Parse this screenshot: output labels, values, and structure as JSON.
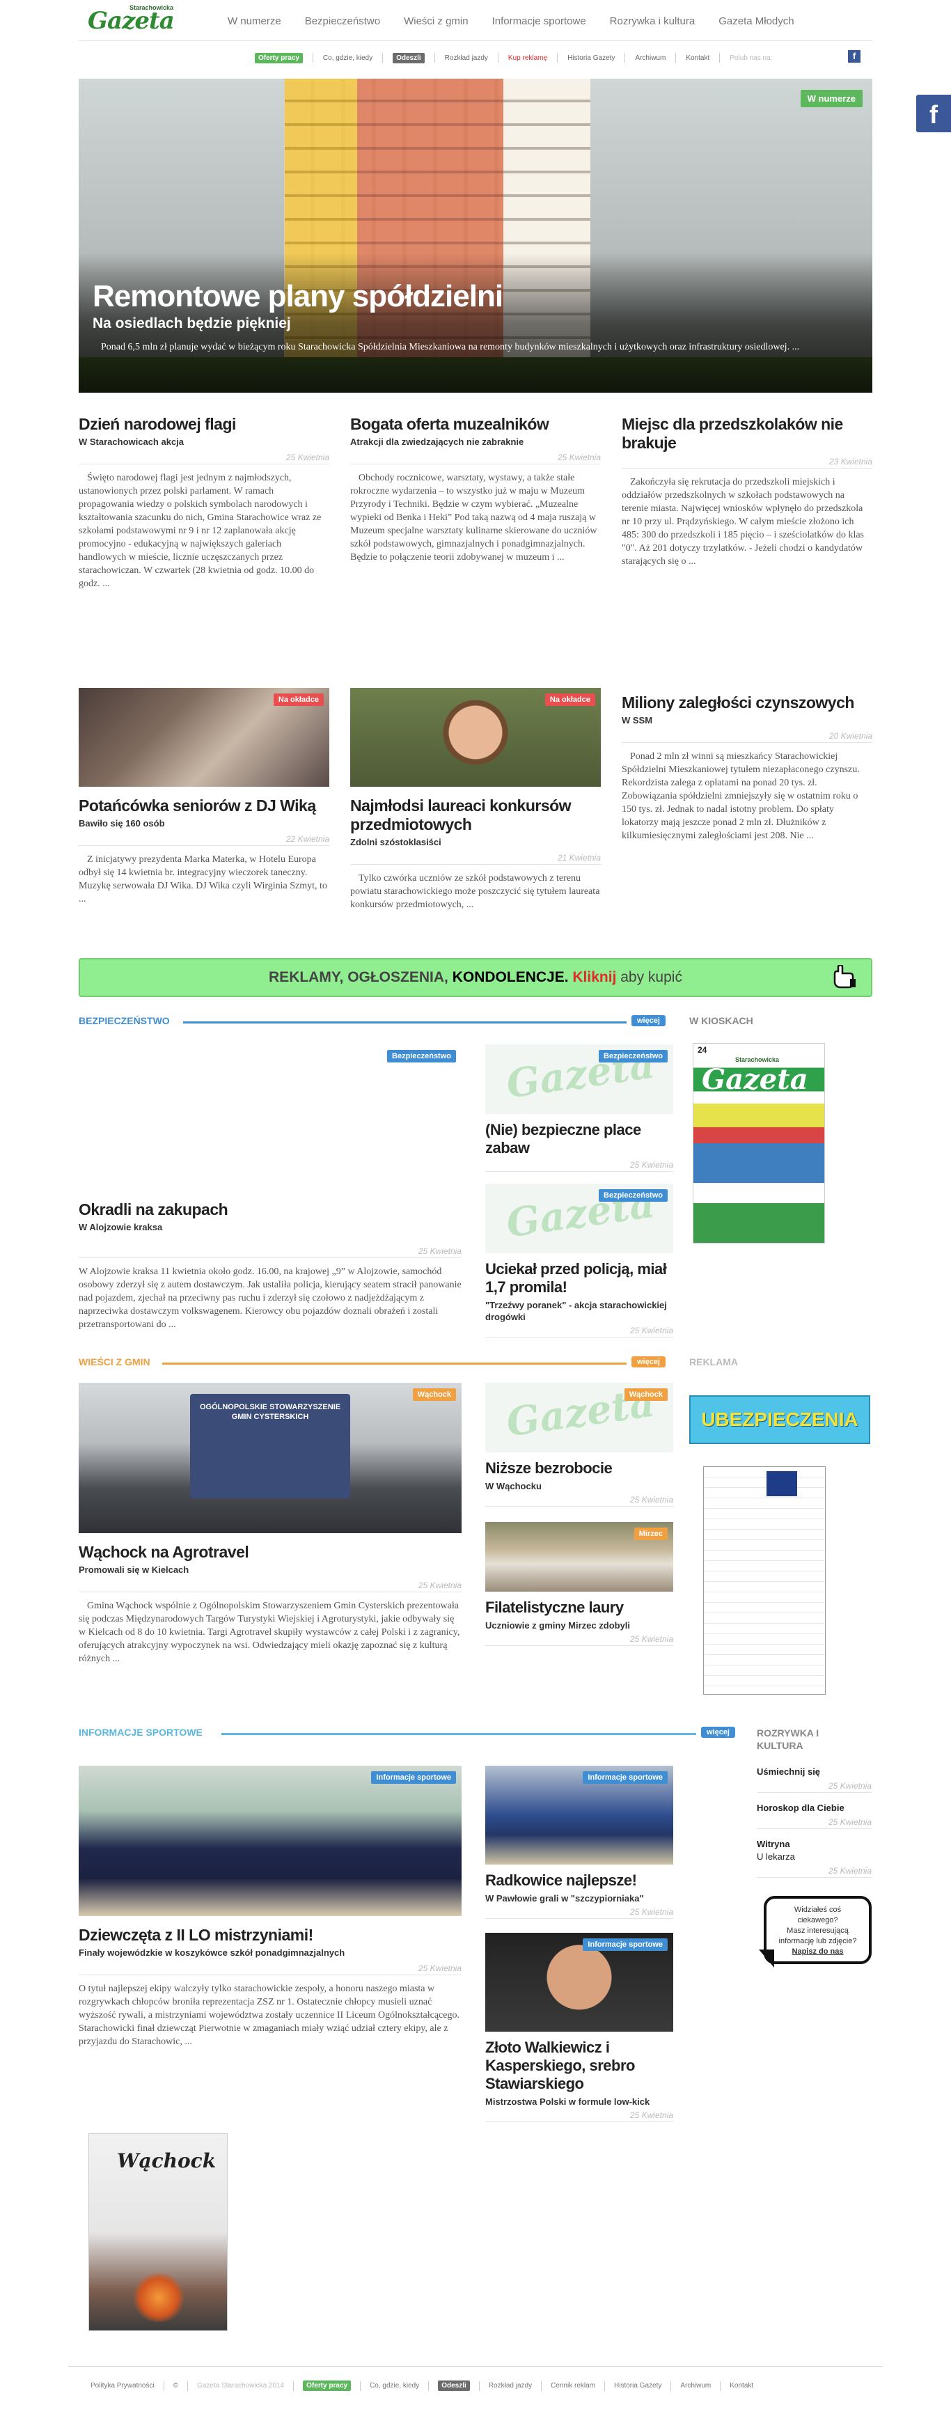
{
  "header": {
    "logo_small": "Starachowicka",
    "logo_big": "Gazeta",
    "nav": [
      "W numerze",
      "Bezpieczeństwo",
      "Wieści z gmin",
      "Informacje sportowe",
      "Rozrywka i kultura",
      "Gazeta Młodych"
    ],
    "subnav": {
      "oferty": "Oferty pracy",
      "co_gdzie": "Co, gdzie, kiedy",
      "odeszli": "Odeszli",
      "rozklad": "Rozkład jazdy",
      "kup": "Kup reklamę",
      "historia": "Historia Gazety",
      "archiwum": "Archiwum",
      "kontakt": "Kontakt",
      "polub": "Polub nas na:"
    },
    "fb_letter": "f"
  },
  "hero": {
    "badge": "W numerze",
    "title": "Remontowe plany spółdzielni",
    "subtitle": "Na osiedlach będzie piękniej",
    "text": "Ponad 6,5 mln zł planuje wydać w bieżącym roku Starachowicka Spółdzielnia Mieszkaniowa na remonty budynków mieszkalnych i użytkowych oraz infrastruktury osiedlowej. ..."
  },
  "row1": [
    {
      "title": "Dzień narodowej flagi",
      "lead": "W Starachowicach akcja",
      "date": "25 Kwietnia",
      "body": "Święto narodowej flagi jest jednym z najmłodszych, ustanowionych przez polski parlament. W ramach propagowania wiedzy o polskich symbolach narodowych i kształtowania szacunku do nich, Gmina Starachowice wraz ze szkołami podstawowymi nr 9 i nr 12 zaplanowała akcję promocyjno - edukacyjną w największych galeriach handlowych w mieście, licznie uczęszczanych przez starachowiczan. W czwartek (28 kwietnia od godz. 10.00 do godz. ..."
    },
    {
      "title": "Bogata oferta muzealników",
      "lead": "Atrakcji dla zwiedzających nie zabraknie",
      "date": "25 Kwietnia",
      "body": "Obchody rocznicowe, warsztaty, wystawy, a także stałe rokroczne wydarzenia – to wszystko już w maju w Muzeum Przyrody i Techniki. Będzie w czym wybierać. „Muzealne wypieki od Benka i Heki” Pod taką nazwą od 4 maja ruszają w Muzeum specjalne warsztaty kulinarne skierowane do uczniów szkół podstawowych, gimnazjalnych i ponadgimnazjalnych. Będzie to połączenie teorii zdobywanej w muzeum i ..."
    },
    {
      "title": "Miejsc dla przedszkolaków nie brakuje",
      "lead": "",
      "date": "23 Kwietnia",
      "body": "Zakończyła się rekrutacja do przedszkoli miejskich i oddziałów przedszkolnych w szkołach podstawowych na terenie miasta. Najwięcej wniosków wpłynęło do przedszkola nr 10 przy ul. Prądzyńskiego. W całym mieście złożono ich 485: 300 do przedszkoli i 185 pięcio – i sześciolatków do klas \"0\". Aż 201 dotyczy trzylatków. - Jeżeli chodzi o kandydatów starających się o ..."
    }
  ],
  "row2": [
    {
      "badge": "Na okładce",
      "title": "Potańcówka seniorów z DJ Wiką",
      "lead": "Bawiło się 160 osób",
      "date": "22 Kwietnia",
      "body": "Z inicjatywy prezydenta Marka Materka, w Hotelu Europa odbył się 14 kwietnia br. integracyjny wieczorek taneczny. Muzykę serwowała DJ Wika. DJ Wika czyli Wirginia Szmyt, to ..."
    },
    {
      "badge": "Na okładce",
      "title": "Najmłodsi laureaci konkursów przedmiotowych",
      "lead": "Zdolni szóstoklasiści",
      "date": "21 Kwietnia",
      "body": "Tylko czwórka uczniów ze szkół podstawowych z terenu powiatu starachowickiego może poszczycić się tytułem laureata konkursów przedmiotowych, ..."
    },
    {
      "title": "Miliony zaległości czynszowych",
      "lead": "W SSM",
      "date": "20 Kwietnia",
      "body": "Ponad 2 mln zł winni są mieszkańcy Starachowickiej Spółdzielni Mieszkaniowej tytułem niezapłaconego czynszu. Rekordzista zalega z opłatami na ponad 20 tys. zł. Zobowiązania spółdzielni zmniejszyły się w ostatnim roku o 150 tys. zł. Jednak to nadal istotny problem. Do spłaty lokatorzy mają jeszcze ponad 2 mln zł. Dłużników z kilkumiesięcznymi zaległościami jest 208. Nie ..."
    }
  ],
  "banner": {
    "part1": "REKLAMY, OGŁOSZENIA, ",
    "part2": "KONDOLENCJE. ",
    "part3": "Kliknij",
    "part4": " aby kupić"
  },
  "bezp": {
    "heading": "Bezpieczeństwo",
    "more": "więcej",
    "main": {
      "badge": "Bezpieczeństwo",
      "title": "Okradli na zakupach",
      "lead": "W Alojzowie kraksa",
      "date": "25 Kwietnia",
      "body": "W Alojzowie kraksa 11 kwietnia około godz. 16.00, na krajowej „9” w Alojzowie, samochód osobowy zderzył się z autem dostawczym. Jak ustaliła policja, kierujący seatem stracił panowanie nad pojazdem, zjechał na przeciwny pas ruchu i zderzył się czołowo z nadjeżdżającym z naprzeciwka dostawczym volkswagenem. Kierowcy obu pojazdów doznali obrażeń i zostali przetransportowani do ..."
    },
    "side": [
      {
        "badge": "Bezpieczeństwo",
        "title": "(Nie) bezpieczne place zabaw",
        "lead": "",
        "date": "25 Kwietnia"
      },
      {
        "badge": "Bezpieczeństwo",
        "title": "Uciekał przed policją, miał 1,7 promila!",
        "lead": "\"Trzeźwy poranek\" - akcja starachowickiej drogówki",
        "date": "25 Kwietnia"
      }
    ]
  },
  "kiosk": {
    "heading": "W kioskach",
    "brand": "Gazeta",
    "brand_small": "Starachowicka",
    "issue": "24"
  },
  "gmin": {
    "heading": "Wieści z gmin",
    "more": "więcej",
    "main": {
      "badge": "Wąchock",
      "title": "Wąchock na Agrotravel",
      "lead": "Promowali się w Kielcach",
      "date": "25 Kwietnia",
      "body": "Gmina Wąchock wspólnie z Ogólnopolskim Stowarzyszeniem Gmin Cysterskich prezentowała się podczas Międzynarodowych Targów Turystyki Wiejskiej i Agroturystyki, jakie odbywały się w Kielcach od 8 do 10 kwietnia. Targi Agrotravel skupiły wystawców z całej Polski i z zagranicy, oferujących atrakcyjny wypoczynek na wsi. Odwiedzający mieli okazję zapoznać się z kulturą różnych ...",
      "photo_sign": "OGÓLNOPOLSKIE STOWARZYSZENIE GMIN CYSTERSKICH"
    },
    "side": [
      {
        "badge": "Wąchock",
        "title": "Niższe bezrobocie",
        "lead": "W Wąchocku",
        "date": "25 Kwietnia"
      },
      {
        "badge": "Mirzec",
        "title": "Filatelistyczne laury",
        "lead": "Uczniowie z gminy Mirzec zdobyli",
        "date": "25 Kwietnia"
      }
    ]
  },
  "reklama": {
    "heading": "Reklama",
    "ad_text": "UBEZPIECZENIA"
  },
  "sport": {
    "heading": "Informacje sportowe",
    "more": "więcej",
    "main": {
      "badge": "Informacje sportowe",
      "title": "Dziewczęta z II LO mistrzyniami!",
      "lead": "Finały wojewódzkie w koszykówce szkół ponadgimnazjalnych",
      "date": "25 Kwietnia",
      "body": "O tytuł najlepszej ekipy walczyły tylko starachowickie zespoły, a honoru naszego miasta w rozgrywkach chłopców broniła reprezentacja ZSZ nr 1. Ostatecznie chłopcy musieli uznać wyższość rywali, a mistrzyniami województwa zostały uczennice II Liceum Ogólnokształcącego. Starachowicki finał dziewcząt Pierwotnie w zmaganiach miały wziąć udział cztery ekipy, ale z przyjazdu do Starachowic, ..."
    },
    "side": [
      {
        "badge": "Informacje sportowe",
        "title": "Radkowice najlepsze!",
        "lead": "W Pawłowie grali w \"szczypiorniaka\"",
        "date": "25 Kwietnia"
      },
      {
        "badge": "Informacje sportowe",
        "title": "Złoto Walkiewicz i Kasperskiego, srebro Stawiarskiego",
        "lead": "Mistrzostwa Polski w formule low-kick",
        "date": "25 Kwietnia"
      }
    ]
  },
  "rozrywka": {
    "heading": "Rozrywka i kultura",
    "items": [
      {
        "title": "Uśmiechnij się",
        "date": "25 Kwietnia"
      },
      {
        "title": "Horoskop dla Ciebie",
        "date": "25 Kwietnia"
      },
      {
        "title": "Witryna",
        "subtitle": "U lekarza",
        "date": "25 Kwietnia"
      }
    ],
    "speech": {
      "l1": "Widziałeś coś",
      "l2": "ciekawego?",
      "l3": "Masz interesującą",
      "l4": "informację lub zdjęcie?",
      "link": "Napisz do nas"
    }
  },
  "poster": {
    "title": "Wąchock"
  },
  "footer": {
    "polityka": "Polityka Prywatności",
    "copyright": "©",
    "brand": "Gazeta Starachowicka 2014",
    "oferty": "Oferty pracy",
    "co_gdzie": "Co, gdzie, kiedy",
    "odeszli": "Odeszli",
    "rozklad": "Rozkład jazdy",
    "cennik": "Cennik reklam",
    "historia": "Historia Gazety",
    "archiwum": "Archiwum",
    "kontakt": "Kontakt"
  },
  "colors": {
    "green": "#5db85d",
    "blue": "#3f8ed3",
    "orange": "#f0a040",
    "light_blue": "#5bb8e0"
  }
}
